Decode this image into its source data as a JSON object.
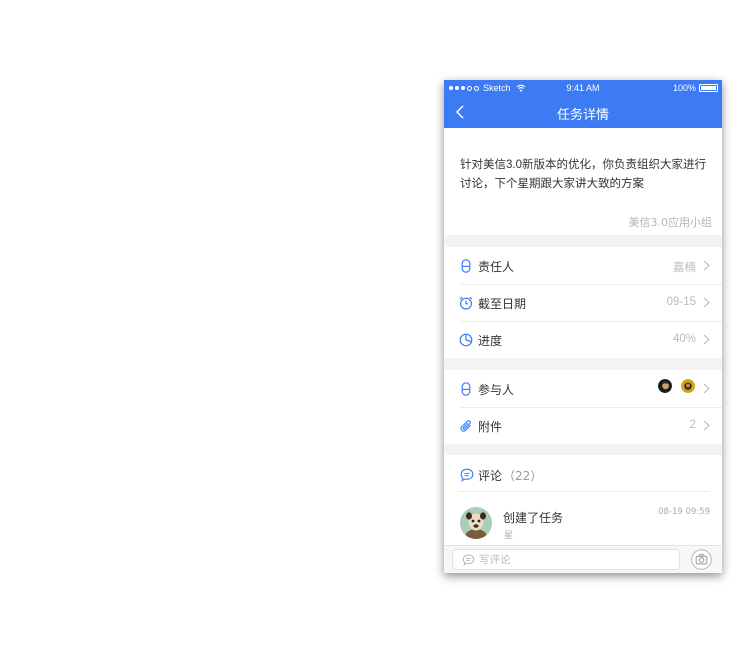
{
  "status_bar": {
    "carrier": "Sketch",
    "time": "9:41 AM",
    "battery": "100%"
  },
  "nav": {
    "title": "任务详情",
    "back": "back"
  },
  "task": {
    "description": "针对美信3.0新版本的优化，你负责组织大家进行讨论，下个星期跟大家讲大致的方案",
    "group": "美信3.0应用小组"
  },
  "details": {
    "assignee": {
      "label": "责任人",
      "value": "嘉楠",
      "icon": "person-icon"
    },
    "deadline": {
      "label": "截至日期",
      "value": "09-15",
      "icon": "alarm-clock-icon"
    },
    "progress": {
      "label": "进度",
      "value": "40%",
      "percent": 40,
      "icon": "pie-progress-icon"
    }
  },
  "people": {
    "participants": {
      "label": "参与人",
      "icon": "person-icon",
      "avatars": [
        "participant-avatar-1",
        "participant-avatar-2"
      ]
    },
    "attachments": {
      "label": "附件",
      "value": "2",
      "icon": "paperclip-icon"
    }
  },
  "comments": {
    "label": "评论",
    "count": "（22）",
    "items": [
      {
        "title": "创建了任务",
        "author": "星",
        "time": "08-19 09:59"
      }
    ]
  },
  "composer": {
    "placeholder": "写评论",
    "camera": "camera-icon"
  },
  "colors": {
    "accent": "#3d7bf5",
    "muted": "#bbbbbb",
    "text": "#333333"
  }
}
